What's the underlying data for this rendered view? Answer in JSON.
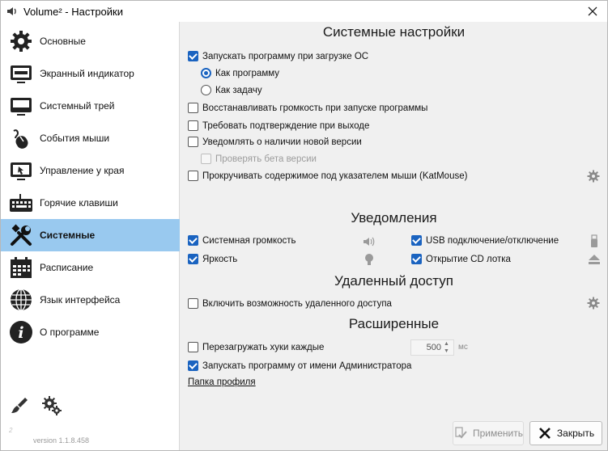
{
  "window": {
    "title": "Volume² - Настройки"
  },
  "sidebar": {
    "items": [
      {
        "label": "Основные",
        "icon": "gear-icon",
        "active": false
      },
      {
        "label": "Экранный индикатор",
        "icon": "monitor-icon",
        "active": false
      },
      {
        "label": "Системный трей",
        "icon": "tray-monitor-icon",
        "active": false
      },
      {
        "label": "События мыши",
        "icon": "mouse-icon",
        "active": false
      },
      {
        "label": "Управление у края",
        "icon": "screen-edge-icon",
        "active": false
      },
      {
        "label": "Горячие клавиши",
        "icon": "keyboard-icon",
        "active": false
      },
      {
        "label": "Системные",
        "icon": "tools-icon",
        "active": true
      },
      {
        "label": "Расписание",
        "icon": "calendar-icon",
        "active": false
      },
      {
        "label": "Язык интерфейса",
        "icon": "globe-icon",
        "active": false
      },
      {
        "label": "О программе",
        "icon": "info-icon",
        "active": false
      }
    ],
    "version": "version 1.1.8.458",
    "logo_mark": "2"
  },
  "system": {
    "heading": "Системные настройки",
    "autostart": {
      "label": "Запускать программу при загрузке ОС",
      "checked": true
    },
    "as_program": {
      "label": "Как программу",
      "selected": true
    },
    "as_task": {
      "label": "Как задачу",
      "selected": false
    },
    "restore_volume": {
      "label": "Восстанавливать громкость при запуске программы",
      "checked": false
    },
    "confirm_exit": {
      "label": "Требовать подтверждение при выходе",
      "checked": false
    },
    "notify_update": {
      "label": "Уведомлять о наличии новой версии",
      "checked": false
    },
    "check_beta": {
      "label": "Проверять бета версии",
      "checked": false,
      "disabled": true
    },
    "katmouse": {
      "label": "Прокручивать содержимое под указателем мыши (KatMouse)",
      "checked": false
    }
  },
  "notifications": {
    "heading": "Уведомления",
    "system_volume": {
      "label": "Системная громкость",
      "checked": true,
      "icon": "speaker-icon"
    },
    "brightness": {
      "label": "Яркость",
      "checked": true,
      "icon": "lightbulb-icon"
    },
    "usb": {
      "label": "USB подключение/отключение",
      "checked": true,
      "icon": "usb-icon"
    },
    "cd_tray": {
      "label": "Открытие CD лотка",
      "checked": true,
      "icon": "eject-icon"
    }
  },
  "remote": {
    "heading": "Удаленный доступ",
    "enable": {
      "label": "Включить возможность удаленного доступа",
      "checked": false
    }
  },
  "advanced": {
    "heading": "Расширенные",
    "reload_hooks": {
      "label": "Перезагружать хуки каждые",
      "checked": false,
      "value": "500",
      "unit": "мс"
    },
    "run_as_admin": {
      "label": "Запускать программу от имени Администратора",
      "checked": true
    },
    "profile_folder": "Папка профиля"
  },
  "footer": {
    "apply_label": "Применить",
    "close_label": "Закрыть"
  },
  "colors": {
    "accent": "#1a63c0",
    "active_nav": "#99c9ef"
  }
}
